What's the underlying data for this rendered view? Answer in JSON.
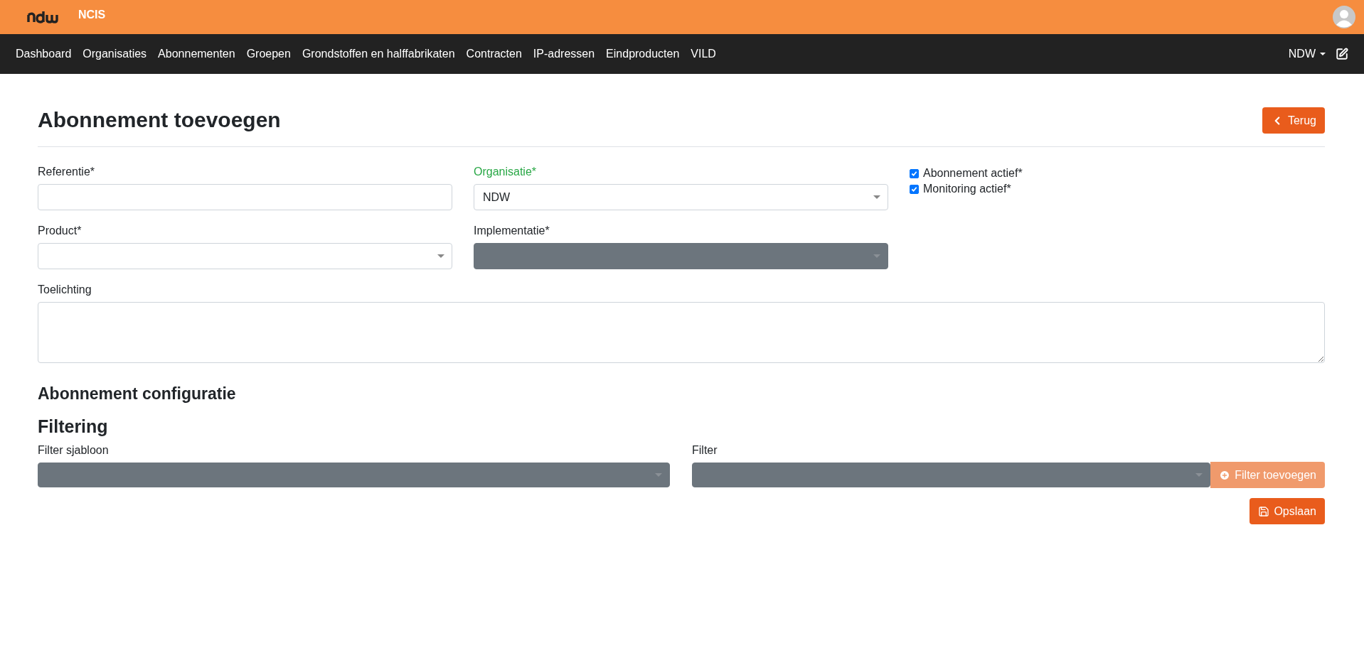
{
  "brand": {
    "app_name": "NCIS"
  },
  "nav": {
    "items": [
      {
        "label": "Dashboard"
      },
      {
        "label": "Organisaties"
      },
      {
        "label": "Abonnementen"
      },
      {
        "label": "Groepen"
      },
      {
        "label": "Grondstoffen en halffabrikaten"
      },
      {
        "label": "Contracten"
      },
      {
        "label": "IP-adressen"
      },
      {
        "label": "Eindproducten"
      },
      {
        "label": "VILD"
      }
    ],
    "user_menu": "NDW"
  },
  "page": {
    "title": "Abonnement toevoegen",
    "back_button": "Terug"
  },
  "form": {
    "fields": [
      {
        "label": "Referentie*",
        "kind": "text",
        "valid": false,
        "disabled": false
      },
      {
        "label": "Organisatie*",
        "kind": "select",
        "valid": true,
        "disabled": false,
        "value": "NDW"
      },
      {
        "label": "Product*",
        "kind": "select",
        "valid": false,
        "disabled": false
      },
      {
        "label": "Implementatie*",
        "kind": "select",
        "valid": false,
        "disabled": true
      }
    ],
    "checkboxes": [
      {
        "label": "Abonnement actief*",
        "checked": true
      },
      {
        "label": "Monitoring actief*",
        "checked": true
      }
    ],
    "notes": {
      "label": "Toelichting"
    }
  },
  "configuration": {
    "title": "Abonnement configuratie",
    "filtering_title": "Filtering",
    "filter_template": {
      "label": "Filter sjabloon",
      "disabled": true
    },
    "filter": {
      "label": "Filter",
      "disabled": true
    },
    "add_filter_button": {
      "label": "Filter toevoegen",
      "disabled": true
    },
    "save_button": "Opslaan"
  }
}
